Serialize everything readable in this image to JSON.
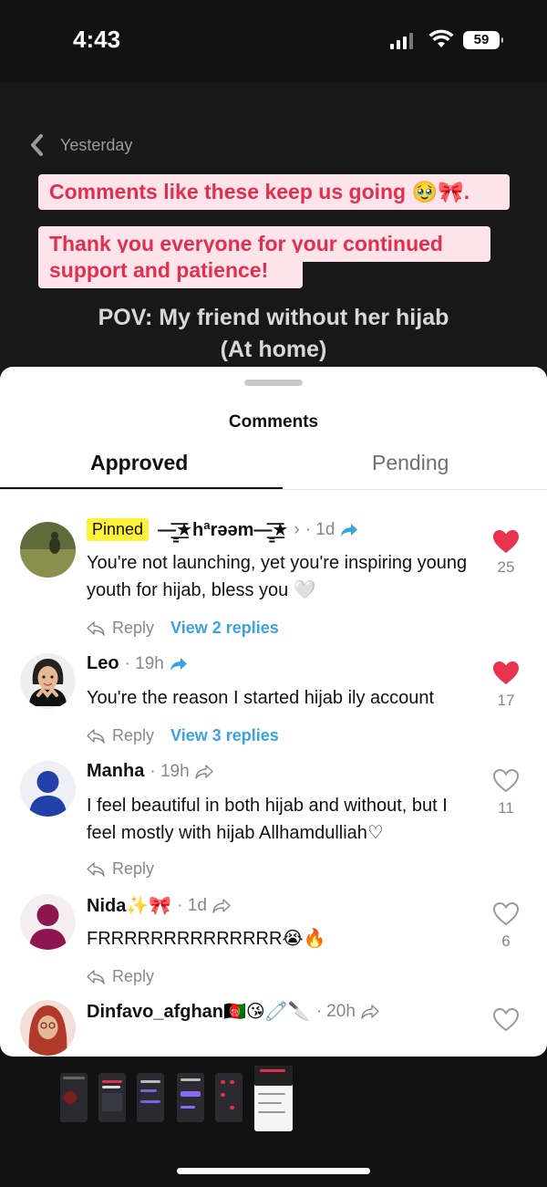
{
  "status_bar": {
    "time": "4:43",
    "battery": "59"
  },
  "story": {
    "back_label": "Yesterday",
    "caption_1": "Comments like these keep us going 🥹🎀.",
    "caption_2a": "Thank you everyone for your continued",
    "caption_2b": "support and patience!",
    "pov_line_1": "POV: My friend without her hijab",
    "pov_line_2": "(At home)"
  },
  "sheet": {
    "title": "Comments",
    "tabs": [
      {
        "label": "Approved",
        "active": true
      },
      {
        "label": "Pending",
        "active": false
      }
    ]
  },
  "comments": [
    {
      "pinned_label": "Pinned",
      "username": "—̳͟͞͞★hªrəəm—̳͟͞͞★",
      "time": "· 1d",
      "text": "You're not launching, yet you're inspiring young youth for hijab, bless you 🤍",
      "reply_label": "Reply",
      "view_replies": "View 2 replies",
      "likes": "25",
      "liked": true
    },
    {
      "username": "Leo",
      "time": "· 19h",
      "text": "You're the reason I started hijab ily account",
      "reply_label": "Reply",
      "view_replies": "View 3 replies",
      "likes": "17",
      "liked": true
    },
    {
      "username": "Manha",
      "time": "· 19h",
      "text": "I feel beautiful in both hijab and without, but I feel mostly with hijab Allhamdulliah♡",
      "reply_label": "Reply",
      "likes": "11",
      "liked": false
    },
    {
      "username": "Nida✨🎀",
      "time": "· 1d",
      "text": "FRRRRRRRRRRRRRR😭🔥",
      "reply_label": "Reply",
      "likes": "6",
      "liked": false
    },
    {
      "username": "Dinfavo_afghan🇦🇫😘🧷🔪",
      "time": "· 20h",
      "liked": false
    }
  ],
  "colors": {
    "like_red": "#e8334d",
    "link_blue": "#3aa3e3",
    "caption_red": "#e0304f",
    "caption_bg": "#fde4ea",
    "pinned_yellow": "#fff238"
  }
}
